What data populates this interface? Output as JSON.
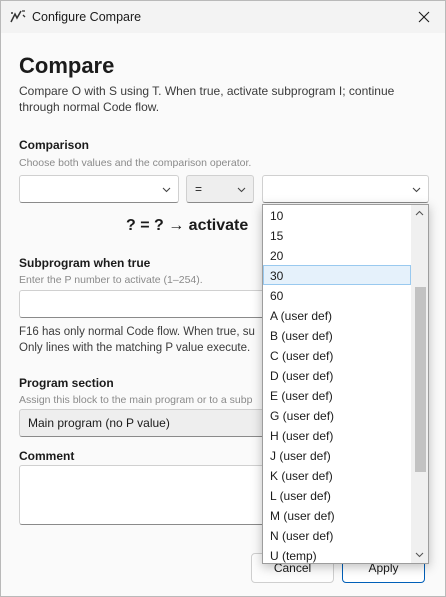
{
  "window": {
    "title": "Configure Compare"
  },
  "header": {
    "title": "Compare",
    "description": "Compare O with S using T. When true, activate subprogram I; continue through normal Code flow."
  },
  "comparison": {
    "label": "Comparison",
    "hint": "Choose both values and the comparison operator.",
    "left_value": "",
    "operator": "=",
    "right_value": ""
  },
  "formula": {
    "text": "? = ?  →  activate"
  },
  "subprogram": {
    "label": "Subprogram when true",
    "hint": "Enter the P number to activate (1–254).",
    "value": "",
    "note_line1": "F16 has only normal Code flow. When true, su",
    "note_line2": "Only lines with the matching P value execute."
  },
  "program_section": {
    "label": "Program section",
    "hint": "Assign this block to the main program or to a subp",
    "selected": "Main program (no P value)"
  },
  "comment": {
    "label": "Comment",
    "value": ""
  },
  "buttons": {
    "cancel": "Cancel",
    "apply": "Apply"
  },
  "dropdown": {
    "selected_index": 3,
    "items": [
      "10",
      "15",
      "20",
      "30",
      "60",
      "A (user def)",
      "B (user def)",
      "C (user def)",
      "D (user def)",
      "E (user def)",
      "G (user def)",
      "H (user def)",
      "J (user def)",
      "K (user def)",
      "L (user def)",
      "M (user def)",
      "N (user def)",
      "U (temp)"
    ]
  },
  "colors": {
    "accent": "#005fb8",
    "selection_bg": "#e5f1fb",
    "selection_border": "#99c9ef"
  }
}
